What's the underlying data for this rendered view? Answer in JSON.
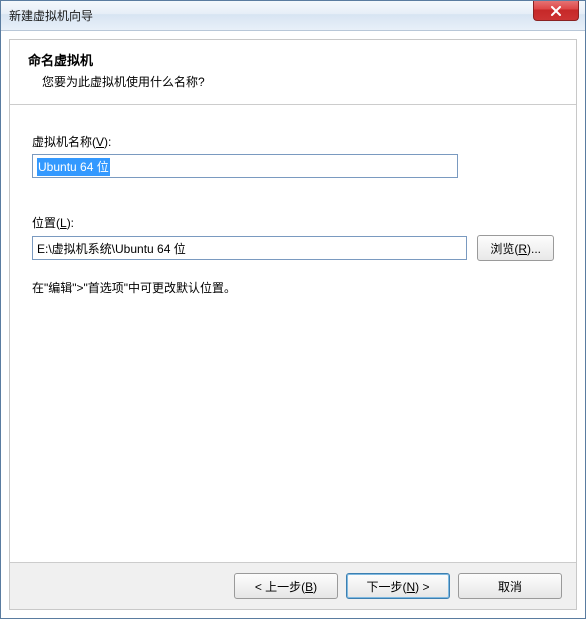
{
  "window": {
    "title": "新建虚拟机向导"
  },
  "header": {
    "title": "命名虚拟机",
    "subtitle": "您要为此虚拟机使用什么名称?"
  },
  "fields": {
    "name": {
      "label_pre": "虚拟机名称(",
      "label_key": "V",
      "label_post": "):",
      "value": "Ubuntu 64 位",
      "selected": true
    },
    "location": {
      "label_pre": "位置(",
      "label_key": "L",
      "label_post": "):",
      "value": "E:\\虚拟机系统\\Ubuntu 64 位"
    },
    "browse": {
      "label_pre": "浏览(",
      "label_key": "R",
      "label_post": ")..."
    }
  },
  "hint": "在\"编辑\">\"首选项\"中可更改默认位置。",
  "footer": {
    "back": {
      "pre": "< 上一步(",
      "key": "B",
      "post": ")"
    },
    "next": {
      "pre": "下一步(",
      "key": "N",
      "post": ") >"
    },
    "cancel": {
      "label": "取消"
    }
  }
}
